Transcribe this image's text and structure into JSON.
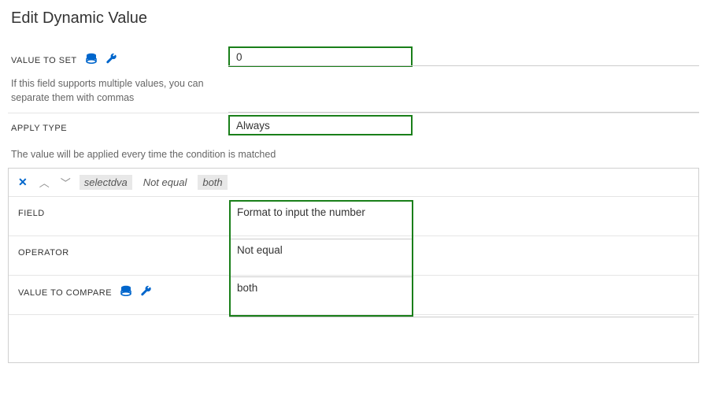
{
  "title": "Edit Dynamic Value",
  "valueToSet": {
    "label": "VALUE TO SET",
    "value": "0",
    "helper": "If this field supports multiple values, you can separate them with commas"
  },
  "applyType": {
    "label": "APPLY TYPE",
    "value": "Always",
    "description": "The value will be applied every time the condition is matched"
  },
  "condition": {
    "chip1": "selectdva",
    "chip2": "Not equal",
    "chip3": "both",
    "field": {
      "label": "FIELD",
      "value": "Format to input the number"
    },
    "operator": {
      "label": "OPERATOR",
      "value": "Not equal"
    },
    "valueToCompare": {
      "label": "VALUE TO COMPARE",
      "value": "both"
    }
  }
}
